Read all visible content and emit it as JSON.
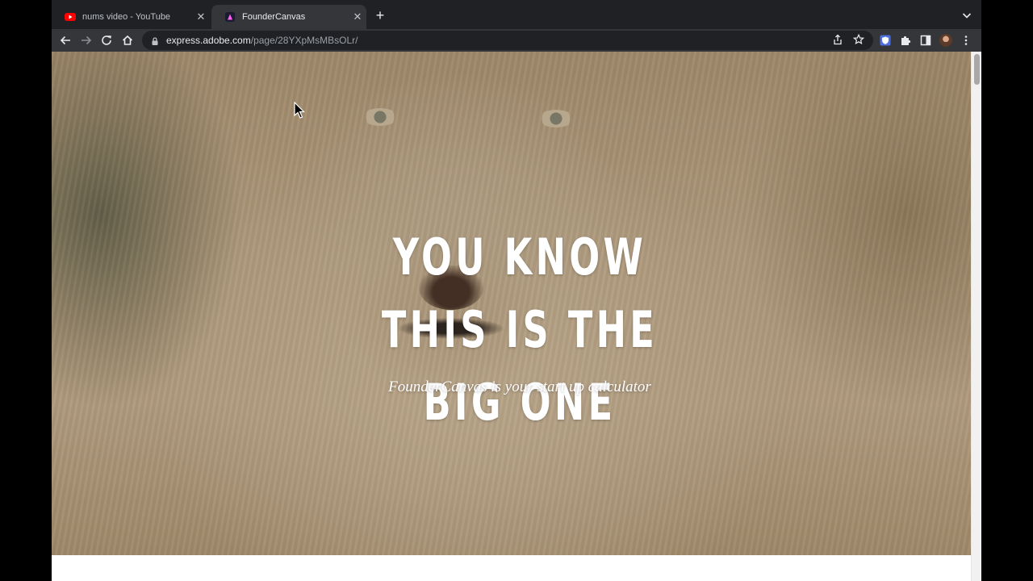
{
  "tabs": [
    {
      "title": "nums video - YouTube",
      "favicon": "youtube-icon",
      "active": false
    },
    {
      "title": "FounderCanvas",
      "favicon": "adobe-express-icon",
      "active": true
    }
  ],
  "toolbar": {
    "url_host": "express.adobe.com",
    "url_path": "/page/28YXpMsMBsOLr/"
  },
  "hero": {
    "headline_line1": "YOU KNOW THIS IS THE",
    "headline_line2": "BIG ONE",
    "subtitle": "FounderCanvas is your start up calculator"
  },
  "colors": {
    "tabstrip_bg": "#202124",
    "toolbar_bg": "#35363a",
    "youtube_red": "#ff0000"
  }
}
